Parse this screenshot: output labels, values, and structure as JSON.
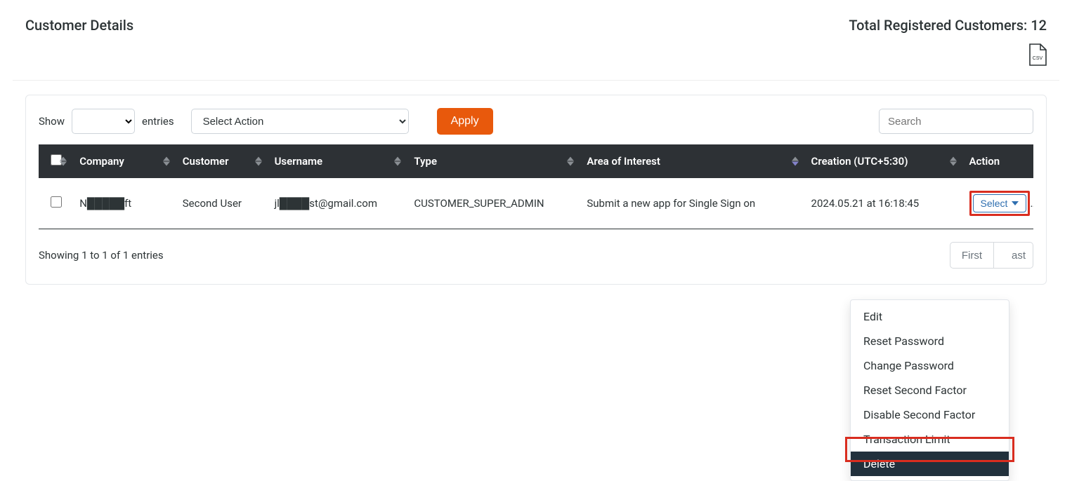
{
  "header": {
    "title": "Customer Details",
    "total_label": "Total Registered Customers: 12"
  },
  "controls": {
    "show_label": "Show",
    "entries_label": "entries",
    "action_select_placeholder": "Select Action",
    "apply_label": "Apply",
    "search_placeholder": "Search"
  },
  "columns": {
    "company": "Company",
    "customer": "Customer",
    "username": "Username",
    "type": "Type",
    "area": "Area of Interest",
    "creation": "Creation (UTC+5:30)",
    "action": "Action"
  },
  "rows": [
    {
      "company": "N█████ft",
      "customer": "Second User",
      "username": "jl████st@gmail.com",
      "type": "CUSTOMER_SUPER_ADMIN",
      "area": "Submit a new app for Single Sign on",
      "creation": "2024.05.21 at 16:18:45",
      "select_label": "Select"
    }
  ],
  "footer": {
    "showing": "Showing 1 to 1 of 1 entries",
    "first": "First",
    "last": "ast"
  },
  "dropdown": {
    "edit": "Edit",
    "reset_password": "Reset Password",
    "change_password": "Change Password",
    "reset_second_factor": "Reset Second Factor",
    "disable_second_factor": "Disable Second Factor",
    "transaction_limit": "Transaction Limit",
    "delete": "Delete"
  }
}
